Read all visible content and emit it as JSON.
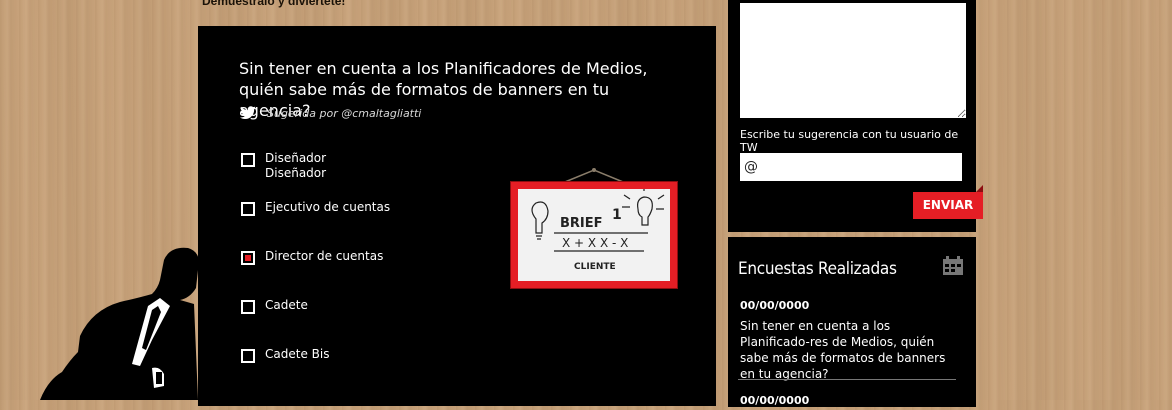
{
  "header": {
    "tagline": "Demuéstralo y diviértete!"
  },
  "poll": {
    "question": "Sin tener en cuenta a los Planificadores de Medios, quién sabe más de formatos de banners en tu agencia?",
    "suggested_by": "Sugerida por @cmaltagliatti",
    "options": [
      {
        "label": "Diseñador",
        "sub_label": "Diseñador",
        "selected": false
      },
      {
        "label": "Ejecutivo de cuentas",
        "selected": false
      },
      {
        "label": "Director de cuentas",
        "selected": true
      },
      {
        "label": "Cadete",
        "selected": false
      },
      {
        "label": "Cadete Bis",
        "selected": false
      }
    ],
    "whiteboard": {
      "word1": "BRIEF",
      "num": "1",
      "formula": "X + X  X - X",
      "word2": "CLIENTE"
    }
  },
  "suggestion": {
    "textarea_value": "",
    "tw_label": "Escribe tu sugerencia con tu usuario de TW",
    "tw_input_value": "@",
    "send_label": "ENVIAR"
  },
  "surveys": {
    "title": "Encuestas Realizadas",
    "items": [
      {
        "date": "00/00/0000",
        "text": "Sin tener en cuenta a los Planificado-res de Medios, quién sabe más de formatos de banners en tu agencia?"
      },
      {
        "date": "00/00/0000",
        "text": ""
      }
    ]
  },
  "colors": {
    "accent": "#e51e25",
    "panel": "#000000",
    "wood": "#c9a47c"
  }
}
